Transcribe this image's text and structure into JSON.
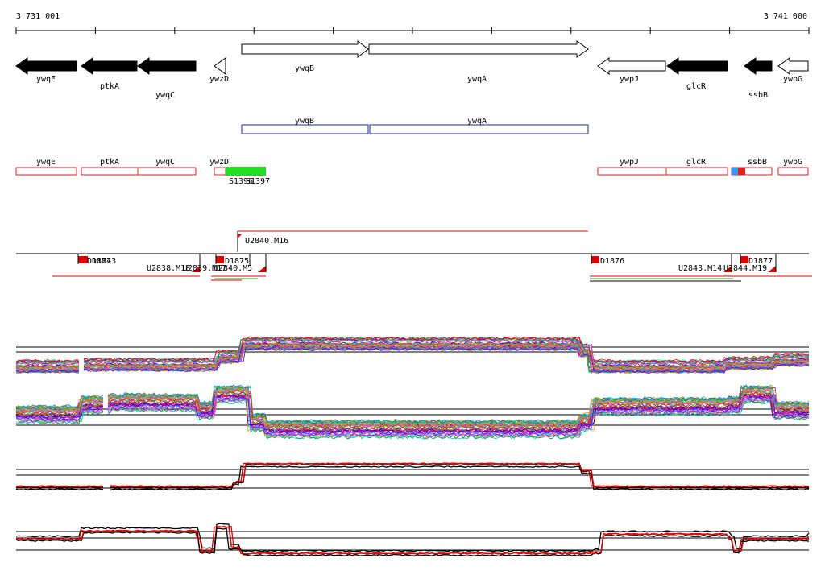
{
  "ruler": {
    "start_label": "3 731 001",
    "end_label": "3 741 000"
  },
  "colors": {
    "gene_solid": "#000000",
    "gene_open": "#ffffff",
    "operon_box": "#1a2a9a",
    "annotation_box": "#e02020",
    "segment_green": "#22dd22",
    "ssb_blue": "#3399ff",
    "track_line": "#000000",
    "condition_red": "#e00000"
  },
  "genes_row": [
    {
      "label": "ywqE",
      "style": "solid",
      "dir": "left"
    },
    {
      "label": "ptkA",
      "style": "solid",
      "dir": "left"
    },
    {
      "label": "ywqC",
      "style": "solid",
      "dir": "left"
    },
    {
      "label": "ywzD",
      "style": "open",
      "dir": "left"
    },
    {
      "label": "ywqB",
      "style": "open",
      "dir": "right"
    },
    {
      "label": "ywqA",
      "style": "open",
      "dir": "right"
    },
    {
      "label": "ywpJ",
      "style": "open",
      "dir": "left"
    },
    {
      "label": "glcR",
      "style": "solid",
      "dir": "left"
    },
    {
      "label": "ssbB",
      "style": "solid",
      "dir": "left"
    },
    {
      "label": "ywpG",
      "style": "open",
      "dir": "left"
    }
  ],
  "operon_row": [
    {
      "label": "ywqB"
    },
    {
      "label": "ywqA"
    }
  ],
  "annotation_row": [
    {
      "label": "ywqE"
    },
    {
      "label": "ptkA"
    },
    {
      "label": "ywqC"
    },
    {
      "label": "ywzD"
    },
    {
      "label": "ywpJ"
    },
    {
      "label": "glcR"
    },
    {
      "label": "ssbB"
    },
    {
      "label": "ywpG"
    }
  ],
  "segments": {
    "s1": "S1396",
    "s2": "S1397"
  },
  "transcript_labels": {
    "main": "U2840.M16",
    "d1874": "D1874",
    "d1873": "D1873",
    "u2838": "U2838.M18",
    "u2839": "U2839.M17",
    "u2840m5": "U2840.M5",
    "d1875": "D1875",
    "d1876": "D1876",
    "u2843": "U2843.M14",
    "u2844": "U2844.M19",
    "d1877": "D1877"
  }
}
